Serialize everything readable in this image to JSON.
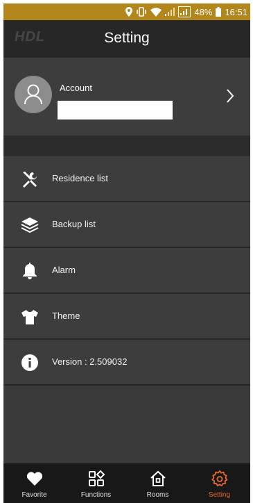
{
  "status_bar": {
    "battery": "48%",
    "time": "16:51"
  },
  "header": {
    "logo": "HDL",
    "title": "Setting"
  },
  "account": {
    "label": "Account",
    "value": ""
  },
  "menu": [
    {
      "label": "Residence list",
      "icon": "tools-icon"
    },
    {
      "label": "Backup list",
      "icon": "layers-icon"
    },
    {
      "label": "Alarm",
      "icon": "bell-icon"
    },
    {
      "label": "Theme",
      "icon": "tshirt-icon"
    },
    {
      "label": "Version : 2.509032",
      "icon": "info-icon"
    }
  ],
  "tabs": [
    {
      "label": "Favorite",
      "icon": "heart-icon"
    },
    {
      "label": "Functions",
      "icon": "functions-grid-icon"
    },
    {
      "label": "Rooms",
      "icon": "home-icon"
    },
    {
      "label": "Setting",
      "icon": "gear-icon",
      "active": true
    }
  ],
  "colors": {
    "status_bar": "#b3861c",
    "accent": "#e9692c",
    "background": "#3a3a3a"
  }
}
